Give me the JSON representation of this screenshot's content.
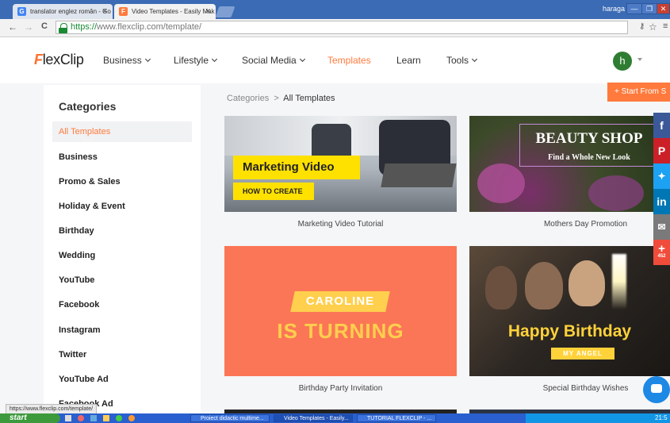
{
  "browser": {
    "tabs": [
      {
        "title": "translator englez român - Go",
        "favicon": "G",
        "color": "#4285f4",
        "active": false
      },
      {
        "title": "Video Templates - Easily Mak",
        "favicon": "F",
        "color": "#ff7a3c",
        "active": true
      }
    ],
    "window_user": "haraga",
    "window_buttons": [
      "—",
      "❐",
      "✕"
    ],
    "nav": {
      "back": "←",
      "forward": "→",
      "reload": "C"
    },
    "url_protocol": "https://",
    "url_rest": "www.flexclip.com/template/",
    "omnibox_icons": [
      "key-icon",
      "star-icon",
      "menu-icon"
    ]
  },
  "site": {
    "logo_f": "F",
    "logo_rest": "lexClip",
    "nav": [
      {
        "label": "Business",
        "dropdown": true
      },
      {
        "label": "Lifestyle",
        "dropdown": true
      },
      {
        "label": "Social Media",
        "dropdown": true
      },
      {
        "label": "Templates",
        "dropdown": false,
        "active": true
      },
      {
        "label": "Learn",
        "dropdown": false
      },
      {
        "label": "Tools",
        "dropdown": true
      }
    ],
    "avatar_letter": "h",
    "start_button": "+ Start From S"
  },
  "sidebar": {
    "title": "Categories",
    "items": [
      {
        "label": "All Templates",
        "active": true
      },
      {
        "label": "Business"
      },
      {
        "label": "Promo & Sales"
      },
      {
        "label": "Holiday & Event"
      },
      {
        "label": "Birthday"
      },
      {
        "label": "Wedding"
      },
      {
        "label": "YouTube"
      },
      {
        "label": "Facebook"
      },
      {
        "label": "Instagram"
      },
      {
        "label": "Twitter"
      },
      {
        "label": "YouTube Ad"
      },
      {
        "label": "Facebook Ad"
      }
    ]
  },
  "breadcrumb": {
    "parent": "Categories",
    "separator": ">",
    "current": "All Templates"
  },
  "templates": [
    {
      "caption": "Marketing Video Tutorial",
      "overlay_title": "Marketing Video",
      "overlay_sub": "HOW TO CREATE"
    },
    {
      "caption": "Mothers Day Promotion",
      "overlay_title": "BEAUTY SHOP",
      "overlay_sub": "Find a Whole New Look"
    },
    {
      "caption": "Birthday Party Invitation",
      "overlay_title": "CAROLINE",
      "overlay_sub": "IS TURNING"
    },
    {
      "caption": "Special Birthday Wishes",
      "overlay_title": "Happy Birthday",
      "overlay_sub": "MY ANGEL"
    }
  ],
  "social": [
    {
      "icon": "facebook-icon",
      "glyph": "f",
      "color": "#3b5998"
    },
    {
      "icon": "pinterest-icon",
      "glyph": "P",
      "color": "#cb2027"
    },
    {
      "icon": "twitter-icon",
      "glyph": "✦",
      "color": "#1da1f2"
    },
    {
      "icon": "linkedin-icon",
      "glyph": "in",
      "color": "#0077b5"
    },
    {
      "icon": "email-icon",
      "glyph": "✉",
      "color": "#7a7a7a"
    },
    {
      "icon": "share-plus-icon",
      "glyph": "+",
      "color": "#f04c3b",
      "count": "452"
    }
  ],
  "status_url": "https://www.flexclip.com/template/",
  "taskbar": {
    "start": "start",
    "tasks": [
      "Proiect didactic multime...",
      "Video Templates - Easily...",
      "TUTORIAL FLEXCLIP - ..."
    ],
    "clock": "21:5"
  },
  "colors": {
    "accent": "#ff7a3c",
    "titlebar": "#3b6bb5",
    "taskbar": "#2a5fcf"
  }
}
